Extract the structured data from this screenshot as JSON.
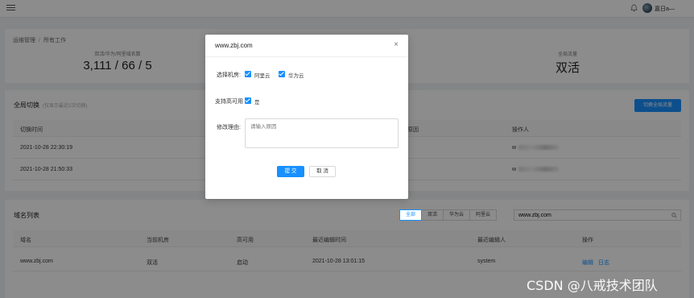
{
  "header": {
    "user_name": "嘉日a—"
  },
  "breadcrumb": {
    "root": "运维管理",
    "current": "所有工作"
  },
  "stats": {
    "counts_label": "双活/华为/阿里域名数",
    "counts_value": "3,111 / 66 / 5",
    "traffic_label": "全局流量",
    "traffic_value": "双活"
  },
  "switch_section": {
    "title": "全局切换",
    "hint": "(仅显示最近2次切换)",
    "switch_button": "切换全局流量",
    "columns": {
      "time": "切换时间",
      "reason": "修改原因",
      "operator": "操作人"
    },
    "rows": [
      {
        "time": "2021-10-28 22:30:19",
        "operator": "w"
      },
      {
        "time": "2021-10-28 21:50:33",
        "operator": "w"
      }
    ]
  },
  "domains": {
    "title": "域名列表",
    "filters": [
      "全部",
      "双活",
      "华为云",
      "阿里云"
    ],
    "active_filter": "全部",
    "search_value": "www.zbj.com",
    "columns": [
      "域名",
      "当前机房",
      "高可用",
      "最近编辑时间",
      "最近编辑人",
      "操作"
    ],
    "rows": [
      {
        "domain": "www.zbj.com",
        "room": "双活",
        "ha": "启动",
        "edit_time": "2021-10-28 13:01:15",
        "editor": "system",
        "edit": "编辑",
        "log": "日志"
      }
    ]
  },
  "modal": {
    "title": "www.zbj.com",
    "close": "×",
    "room_label": "选择机房:",
    "room_options": [
      "阿里云",
      "华为云"
    ],
    "ha_label": "支持高可用",
    "ha_option": "是",
    "reason_label": "修改理由:",
    "reason_placeholder": "请输入原因",
    "submit": "提 交",
    "cancel": "取 消"
  },
  "watermark": "CSDN @八戒技术团队",
  "colors": {
    "primary": "#1890ff",
    "mask": "rgba(0,0,0,0.45)"
  }
}
